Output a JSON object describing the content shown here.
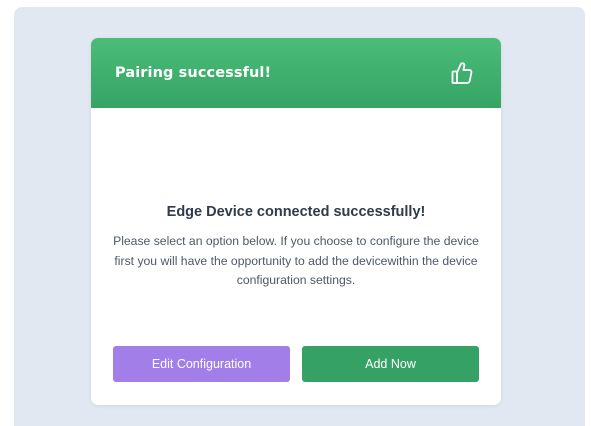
{
  "modal": {
    "title": "Pairing successful!",
    "header_icon": "thumbs-up-icon",
    "heading": "Edge Device connected successfully!",
    "message": "Please select an option below. If you choose to configure the device first you will have the opportunity to add the devicewithin the device configuration settings.",
    "buttons": {
      "edit_label": "Edit Configuration",
      "add_label": "Add Now"
    }
  },
  "colors": {
    "header_green": "#3fb26f",
    "backdrop": "#e1e8f1",
    "edit_button": "#a27ee8",
    "add_button": "#36a164",
    "heading_text": "#2f3a4a"
  }
}
